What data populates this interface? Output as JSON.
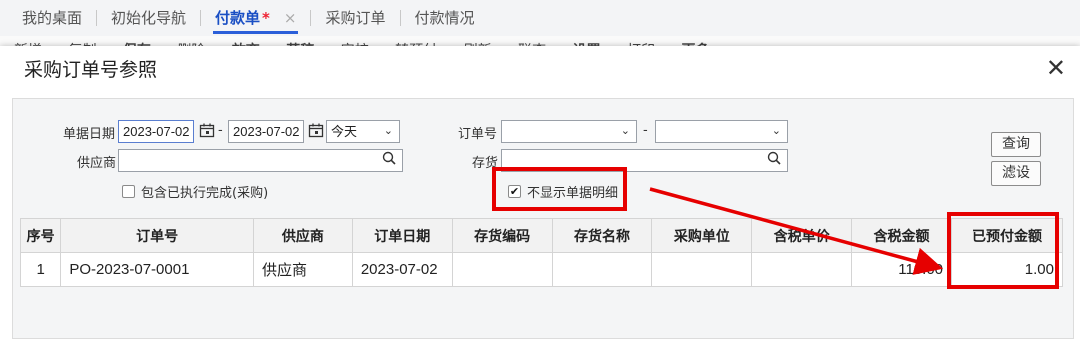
{
  "tabs": [
    {
      "label": "我的桌面"
    },
    {
      "label": "初始化导航"
    },
    {
      "label": "付款单",
      "modified": "*",
      "close": "×"
    },
    {
      "label": "采购订单"
    },
    {
      "label": "付款情况"
    }
  ],
  "toolbar_behind": [
    "新增",
    "复制",
    "保存",
    "删除",
    "放弃",
    "草稿",
    "审核",
    "转预付",
    "刷新",
    "联查",
    "设置",
    "打印",
    "更多"
  ],
  "dialog": {
    "title": "采购订单号参照",
    "close": "✕"
  },
  "filters": {
    "date_label": "单据日期",
    "date_from": "2023-07-02",
    "date_to": "2023-07-02",
    "date_sep": "-",
    "date_preset": "今天",
    "order_label": "订单号",
    "order_sep": "-",
    "supplier_label": "供应商",
    "inventory_label": "存货",
    "include_completed_label": "包含已执行完成(采购)",
    "hide_detail_label": "不显示单据明细",
    "hide_detail_checked": true,
    "include_completed_checked": false
  },
  "buttons": {
    "query": "查询",
    "filter": "滤设"
  },
  "table": {
    "headers": [
      "序号",
      "订单号",
      "供应商",
      "订单日期",
      "存货编码",
      "存货名称",
      "采购单位",
      "含税单价",
      "含税金额",
      "已预付金额"
    ],
    "rows": [
      [
        "1",
        "PO-2023-07-0001",
        "供应商",
        "2023-07-02",
        "",
        "",
        "",
        "",
        "110.00",
        "1.00"
      ]
    ]
  },
  "colors": {
    "annotation": "#e60000",
    "active_tab": "#1a4fc4"
  }
}
